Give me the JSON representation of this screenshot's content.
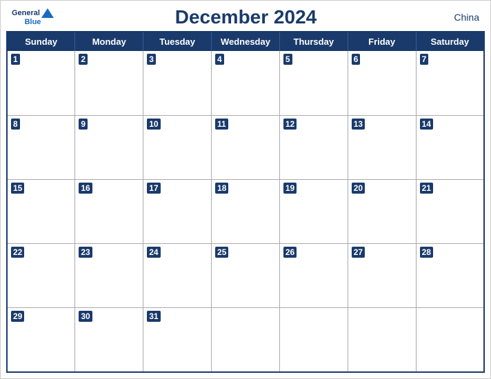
{
  "header": {
    "logo_general": "General",
    "logo_blue": "Blue",
    "title": "December 2024",
    "country": "China"
  },
  "weekdays": [
    "Sunday",
    "Monday",
    "Tuesday",
    "Wednesday",
    "Thursday",
    "Friday",
    "Saturday"
  ],
  "weeks": [
    [
      {
        "day": 1,
        "active": true
      },
      {
        "day": 2,
        "active": true
      },
      {
        "day": 3,
        "active": true
      },
      {
        "day": 4,
        "active": true
      },
      {
        "day": 5,
        "active": true
      },
      {
        "day": 6,
        "active": true
      },
      {
        "day": 7,
        "active": true
      }
    ],
    [
      {
        "day": 8,
        "active": true
      },
      {
        "day": 9,
        "active": true
      },
      {
        "day": 10,
        "active": true
      },
      {
        "day": 11,
        "active": true
      },
      {
        "day": 12,
        "active": true
      },
      {
        "day": 13,
        "active": true
      },
      {
        "day": 14,
        "active": true
      }
    ],
    [
      {
        "day": 15,
        "active": true
      },
      {
        "day": 16,
        "active": true
      },
      {
        "day": 17,
        "active": true
      },
      {
        "day": 18,
        "active": true
      },
      {
        "day": 19,
        "active": true
      },
      {
        "day": 20,
        "active": true
      },
      {
        "day": 21,
        "active": true
      }
    ],
    [
      {
        "day": 22,
        "active": true
      },
      {
        "day": 23,
        "active": true
      },
      {
        "day": 24,
        "active": true
      },
      {
        "day": 25,
        "active": true
      },
      {
        "day": 26,
        "active": true
      },
      {
        "day": 27,
        "active": true
      },
      {
        "day": 28,
        "active": true
      }
    ],
    [
      {
        "day": 29,
        "active": true
      },
      {
        "day": 30,
        "active": true
      },
      {
        "day": 31,
        "active": true
      },
      {
        "day": null,
        "active": false
      },
      {
        "day": null,
        "active": false
      },
      {
        "day": null,
        "active": false
      },
      {
        "day": null,
        "active": false
      }
    ]
  ],
  "colors": {
    "header_bg": "#1a3a6b",
    "header_text": "#ffffff",
    "title_color": "#1a3a6b",
    "border_color": "#1a3a6b"
  }
}
